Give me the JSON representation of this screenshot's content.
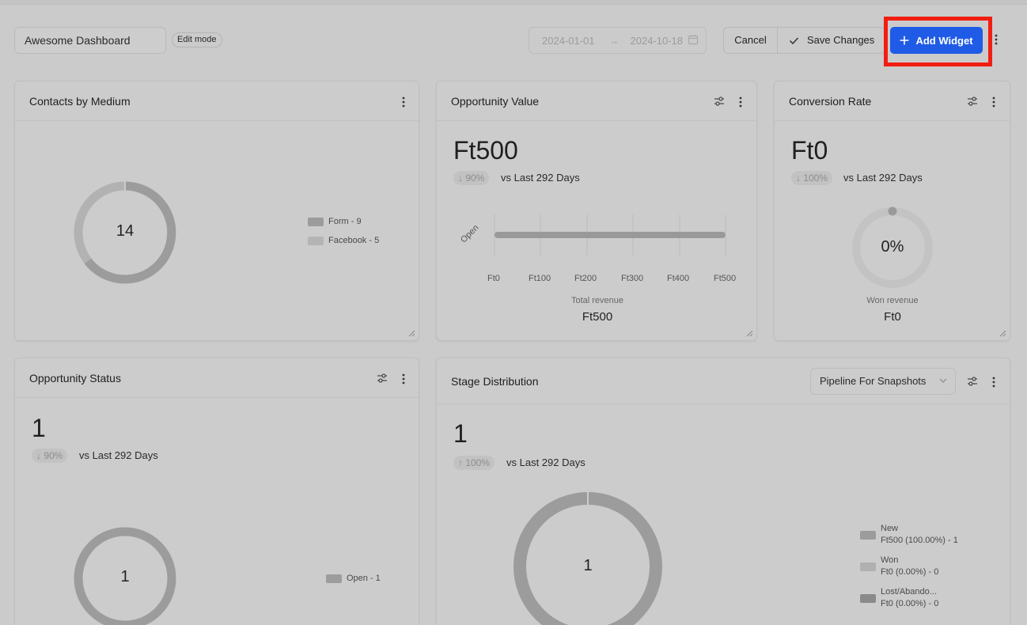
{
  "header": {
    "dashboard_name": "Awesome Dashboard",
    "mode_badge": "Edit mode",
    "date_start": "2024-01-01",
    "date_end": "2024-10-18",
    "cancel_label": "Cancel",
    "save_label": "Save Changes",
    "add_widget_label": "Add Widget"
  },
  "widgets": {
    "contacts": {
      "title": "Contacts by Medium",
      "total": "14",
      "legend": [
        {
          "label": "Form - 9",
          "color": "#9c9c9c"
        },
        {
          "label": "Facebook - 5",
          "color": "#b4b4b4"
        }
      ]
    },
    "opp_value": {
      "title": "Opportunity Value",
      "value": "Ft500",
      "trend": "↓ 90%",
      "vs": "vs Last 292 Days",
      "bar_label": "Open",
      "bar_fraction": 1.0,
      "ticks": [
        "Ft0",
        "Ft100",
        "Ft200",
        "Ft300",
        "Ft400",
        "Ft500"
      ],
      "caption": "Total revenue",
      "caption_value": "Ft500"
    },
    "conversion": {
      "title": "Conversion Rate",
      "value": "Ft0",
      "trend": "↓ 100%",
      "vs": "vs Last 292 Days",
      "gauge": "0%",
      "caption": "Won revenue",
      "caption_value": "Ft0"
    },
    "opp_status": {
      "title": "Opportunity Status",
      "value": "1",
      "trend": "↓ 90%",
      "vs": "vs Last 292 Days",
      "donut_center": "1",
      "legend": [
        {
          "label": "Open - 1",
          "color": "#9c9c9c"
        }
      ]
    },
    "stage": {
      "title": "Stage Distribution",
      "pipeline": "Pipeline For Snapshots",
      "value": "1",
      "trend": "↑ 100%",
      "vs": "vs Last 292 Days",
      "donut_center": "1",
      "legend": [
        {
          "name": "New",
          "detail": "Ft500 (100.00%) - 1",
          "color": "#9c9c9c"
        },
        {
          "name": "Won",
          "detail": "Ft0 (0.00%) - 0",
          "color": "#b0b0b0"
        },
        {
          "name": "Lost/Abando...",
          "detail": "Ft0 (0.00%) - 0",
          "color": "#8a8a8a"
        }
      ]
    }
  },
  "colors": {
    "accent": "#1f5be6",
    "highlight": "#f21d12"
  }
}
